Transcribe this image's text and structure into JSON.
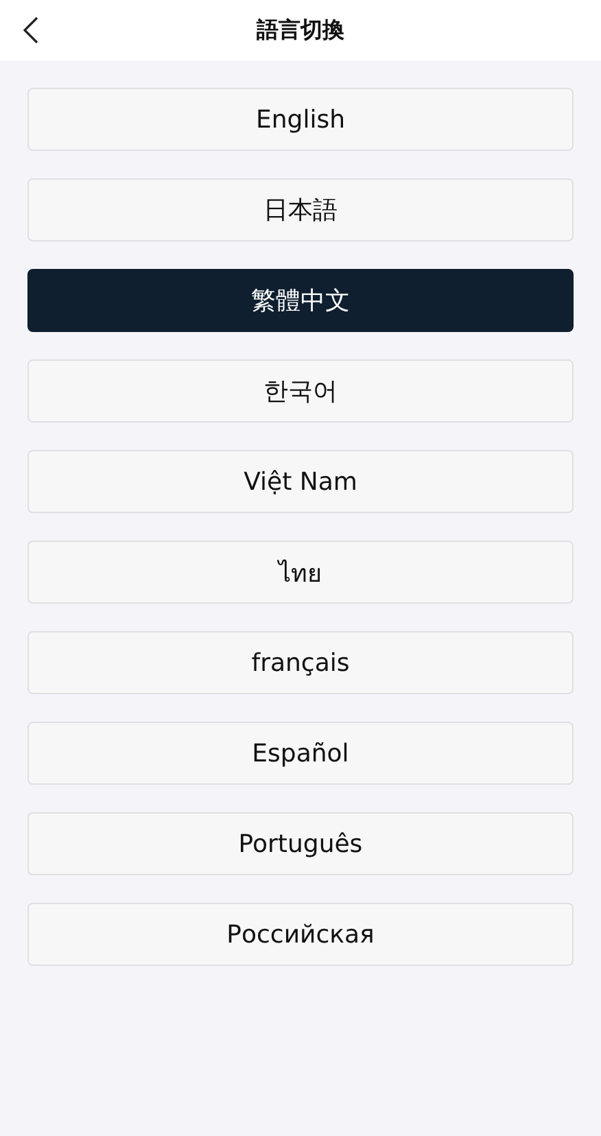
{
  "header": {
    "title": "語言切換"
  },
  "languages": [
    {
      "label": "English",
      "selected": false
    },
    {
      "label": "日本語",
      "selected": false
    },
    {
      "label": "繁體中文",
      "selected": true
    },
    {
      "label": "한국어",
      "selected": false
    },
    {
      "label": "Việt Nam",
      "selected": false
    },
    {
      "label": "ไทย",
      "selected": false
    },
    {
      "label": "français",
      "selected": false
    },
    {
      "label": "Español",
      "selected": false
    },
    {
      "label": "Português",
      "selected": false
    },
    {
      "label": "Российская",
      "selected": false
    }
  ]
}
